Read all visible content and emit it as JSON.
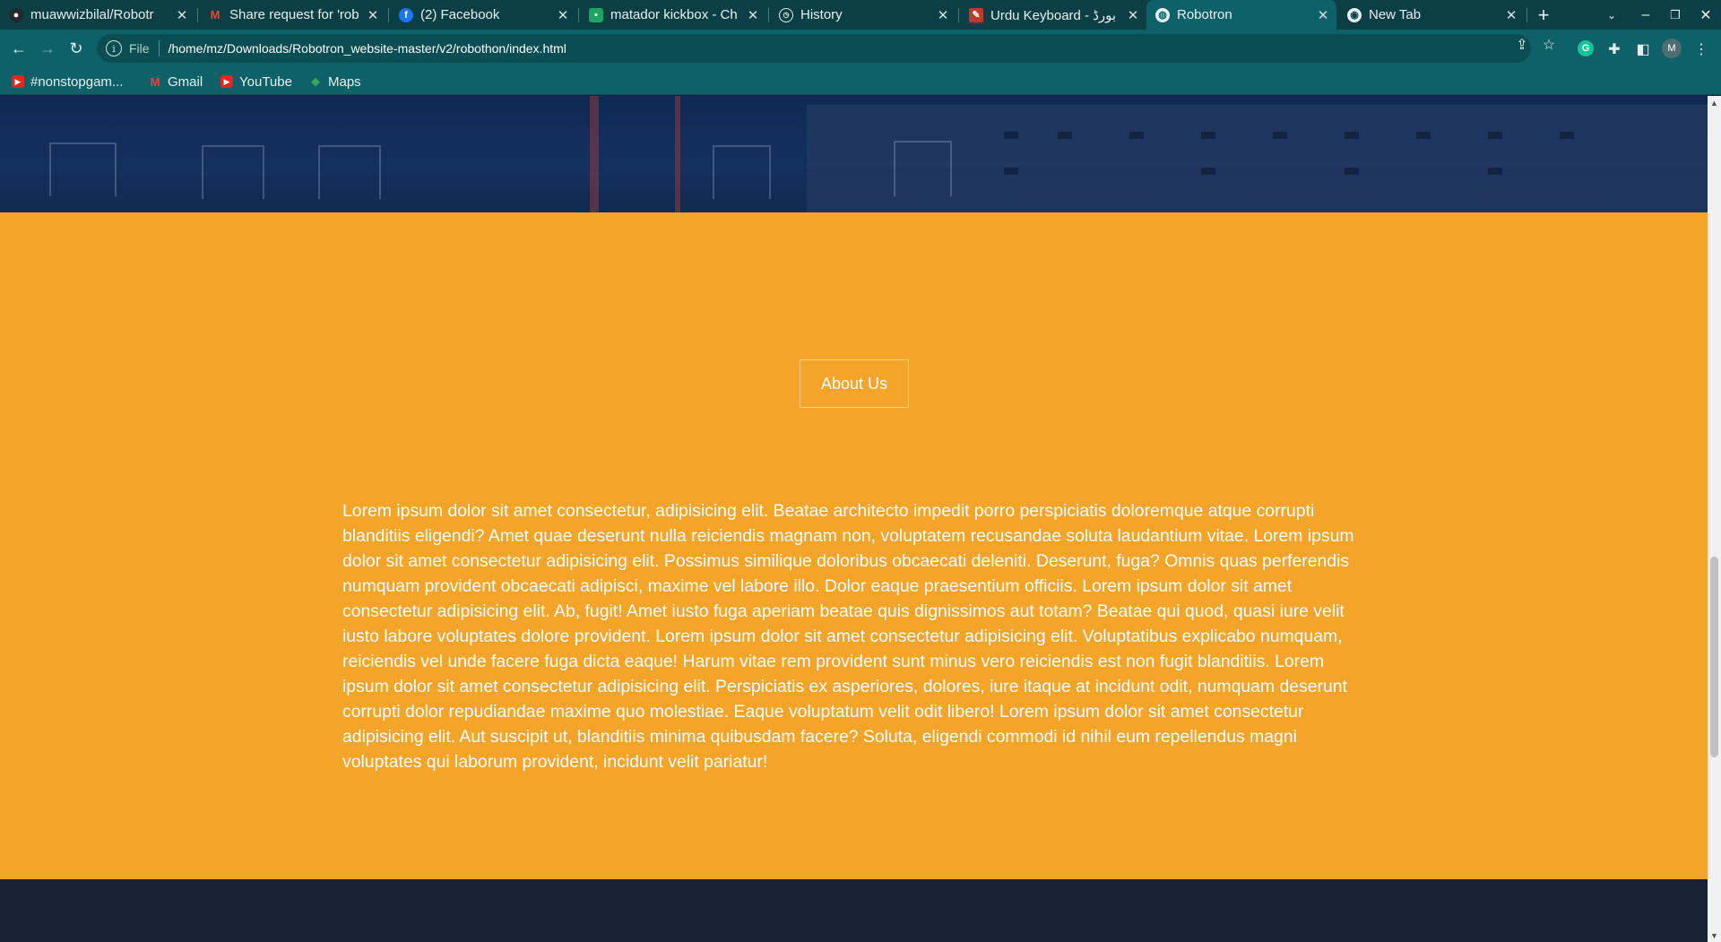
{
  "browser": {
    "tabs": [
      {
        "title": "muawwizbilal/Robotr",
        "icon": "github-icon",
        "active": false
      },
      {
        "title": "Share request for 'rob",
        "icon": "gmail-icon",
        "active": false
      },
      {
        "title": "(2) Facebook",
        "icon": "facebook-icon",
        "active": false
      },
      {
        "title": "matador kickbox - Ch",
        "icon": "chat-icon",
        "active": false
      },
      {
        "title": "History",
        "icon": "history-icon",
        "active": false
      },
      {
        "title": "Urdu Keyboard - ﺑﻮﺭﮈ",
        "icon": "keyboard-icon",
        "active": false
      },
      {
        "title": "Robotron",
        "icon": "globe-icon",
        "active": true
      },
      {
        "title": "New Tab",
        "icon": "chrome-icon",
        "active": false
      }
    ],
    "address": {
      "scheme": "File",
      "url": "/home/mz/Downloads/Robotron_website-master/v2/robothon/index.html"
    },
    "profile_initial": "M",
    "extension_initial": "G",
    "bookmarks": [
      {
        "label": "#nonstopgam...",
        "icon": "youtube-icon"
      },
      {
        "label": "Gmail",
        "icon": "gmail-icon"
      },
      {
        "label": "YouTube",
        "icon": "youtube-icon"
      },
      {
        "label": "Maps",
        "icon": "maps-icon"
      }
    ]
  },
  "page": {
    "about_button": "About Us",
    "about_text": "Lorem ipsum dolor sit amet consectetur, adipisicing elit. Beatae architecto impedit porro perspiciatis doloremque atque corrupti blanditiis eligendi? Amet quae deserunt nulla reiciendis magnam non, voluptatem recusandae soluta laudantium vitae. Lorem ipsum dolor sit amet consectetur adipisicing elit. Possimus similique doloribus obcaecati deleniti. Deserunt, fuga? Omnis quas perferendis numquam provident obcaecati adipisci, maxime vel labore illo. Dolor eaque praesentium officiis. Lorem ipsum dolor sit amet consectetur adipisicing elit. Ab, fugit! Amet iusto fuga aperiam beatae quis dignissimos aut totam? Beatae qui quod, quasi iure velit iusto labore voluptates dolore provident. Lorem ipsum dolor sit amet consectetur adipisicing elit. Voluptatibus explicabo numquam, reiciendis vel unde facere fuga dicta eaque! Harum vitae rem provident sunt minus vero reiciendis est non fugit blanditiis. Lorem ipsum dolor sit amet consectetur adipisicing elit. Perspiciatis ex asperiores, dolores, iure itaque at incidunt odit, numquam deserunt corrupti dolor repudiandae maxime quo molestiae. Eaque voluptatum velit odit libero! Lorem ipsum dolor sit amet consectetur adipisicing elit. Aut suscipit ut, blanditiis minima quibusdam facere? Soluta, eligendi commodi id nihil eum repellendus magni voluptates qui laborum provident, incidunt velit pariatur!"
  },
  "colors": {
    "chrome_dark": "#0b3f45",
    "chrome": "#0e6168",
    "hero": "#14305d",
    "about_bg": "#f5a42a",
    "footer_bg": "#1a2238"
  }
}
